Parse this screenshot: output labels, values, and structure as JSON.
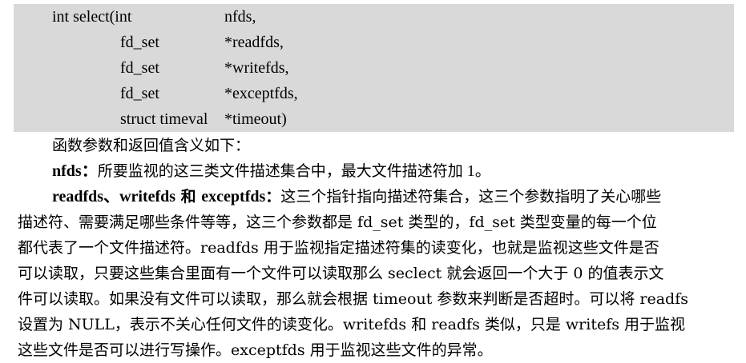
{
  "code": {
    "lines": [
      {
        "type": "int select(int",
        "param": "nfds,"
      },
      {
        "type": "fd_set",
        "param": "*readfds,"
      },
      {
        "type": "fd_set",
        "param": "*writefds,"
      },
      {
        "type": "fd_set",
        "param": "*exceptfds,"
      },
      {
        "type": "struct timeval",
        "param": "*timeout)"
      }
    ]
  },
  "intro": "函数参数和返回值含义如下：",
  "nfds": {
    "term": "nfds：",
    "desc_cn": "所要监视的这三类文件描述集合中，最大文件描述符加",
    "desc_num": " 1。"
  },
  "sets": {
    "term_a": "readfds、writefds",
    "term_b": " 和 ",
    "term_c": "exceptfds",
    "term_d": "：",
    "line1_rest": "这三个指针指向描述符集合，这三个参数指明了关心哪些",
    "line2": "描述符、需要满足哪些条件等等，这三个参数都是 fd_set 类型的，fd_set 类型变量的每一个位",
    "line3": "都代表了一个文件描述符。readfds 用于监视指定描述符集的读变化，也就是监视这些文件是否",
    "line4": "可以读取，只要这些集合里面有一个文件可以读取那么 seclect 就会返回一个大于 0 的值表示文",
    "line5": "件可以读取。如果没有文件可以读取，那么就会根据 timeout 参数来判断是否超时。可以将 readfs",
    "line6": "设置为 NULL，表示不关心任何文件的读变化。writefds 和 readfs 类似，只是 writefs 用于监视",
    "line7": "这些文件是否可以进行写操作。exceptfds 用于监视这些文件的异常。"
  }
}
